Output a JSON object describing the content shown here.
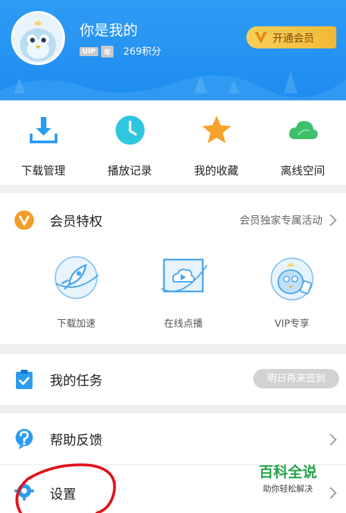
{
  "header": {
    "username": "你是我的",
    "badge_uip": "UIP",
    "badge_year": "年",
    "points": "269积分",
    "vip_button": "开通会员"
  },
  "quick_actions": [
    {
      "label": "下载管理",
      "icon": "download-icon",
      "color": "#2c9cf0"
    },
    {
      "label": "播放记录",
      "icon": "clock-icon",
      "color": "#2fc6e0"
    },
    {
      "label": "我的收藏",
      "icon": "star-icon",
      "color": "#f7a22b"
    },
    {
      "label": "离线空间",
      "icon": "cloud-icon",
      "color": "#3cc06b"
    }
  ],
  "vip_section": {
    "title": "会员特权",
    "more": "会员独家专属活动",
    "items": [
      {
        "label": "下载加速",
        "icon": "rocket-icon"
      },
      {
        "label": "在线点播",
        "icon": "screen-play-icon"
      },
      {
        "label": "VIP专享",
        "icon": "mascot-icon"
      }
    ]
  },
  "tasks": {
    "title": "我的任务",
    "button": "明日再来签到"
  },
  "help": {
    "title": "帮助反馈"
  },
  "settings": {
    "title": "设置"
  },
  "watermark": {
    "title": "百科全说",
    "subtitle": "助你轻松解决"
  },
  "colors": {
    "header": "#1e8cf0",
    "vip": "#f29d2a",
    "accent": "#2c9cf0",
    "annotation": "#e0141a"
  }
}
